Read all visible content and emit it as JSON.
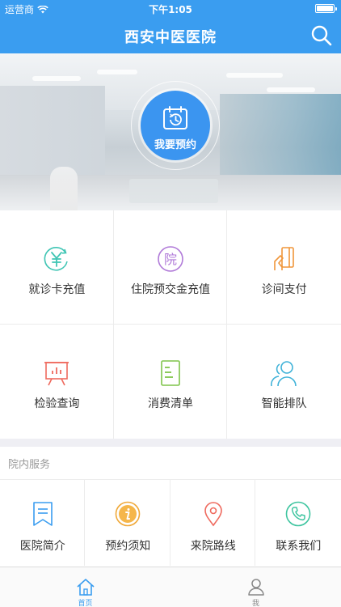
{
  "status_bar": {
    "carrier": "运营商",
    "time": "下午1:05"
  },
  "nav": {
    "title": "西安中医医院",
    "search_icon": "search-icon"
  },
  "hero": {
    "book_label": "我要预约",
    "accent": "#3b95f0"
  },
  "grid": [
    {
      "label": "就诊卡充值",
      "icon": "yuan-card-icon",
      "color": "#3fc5b4"
    },
    {
      "label": "住院预交金充值",
      "icon": "hospital-char-icon",
      "color": "#b07ad8"
    },
    {
      "label": "诊间支付",
      "icon": "card-payment-icon",
      "color": "#f0963a"
    },
    {
      "label": "检验查询",
      "icon": "easel-chart-icon",
      "color": "#ef6a5e"
    },
    {
      "label": "消费清单",
      "icon": "bill-list-icon",
      "color": "#7fc44a"
    },
    {
      "label": "智能排队",
      "icon": "queue-people-icon",
      "color": "#3fb2d8"
    }
  ],
  "section": {
    "title": "院内服务"
  },
  "services": [
    {
      "label": "医院简介",
      "icon": "bookmark-icon",
      "color": "#3a9df0"
    },
    {
      "label": "预约须知",
      "icon": "info-icon",
      "color": "#f0a93a"
    },
    {
      "label": "来院路线",
      "icon": "map-pin-icon",
      "color": "#ef6a5e"
    },
    {
      "label": "联系我们",
      "icon": "phone-icon",
      "color": "#3fc5a0"
    }
  ],
  "tabbar": [
    {
      "label": "首页",
      "icon": "home-icon",
      "active": true
    },
    {
      "label": "我",
      "icon": "user-icon",
      "active": false
    }
  ]
}
